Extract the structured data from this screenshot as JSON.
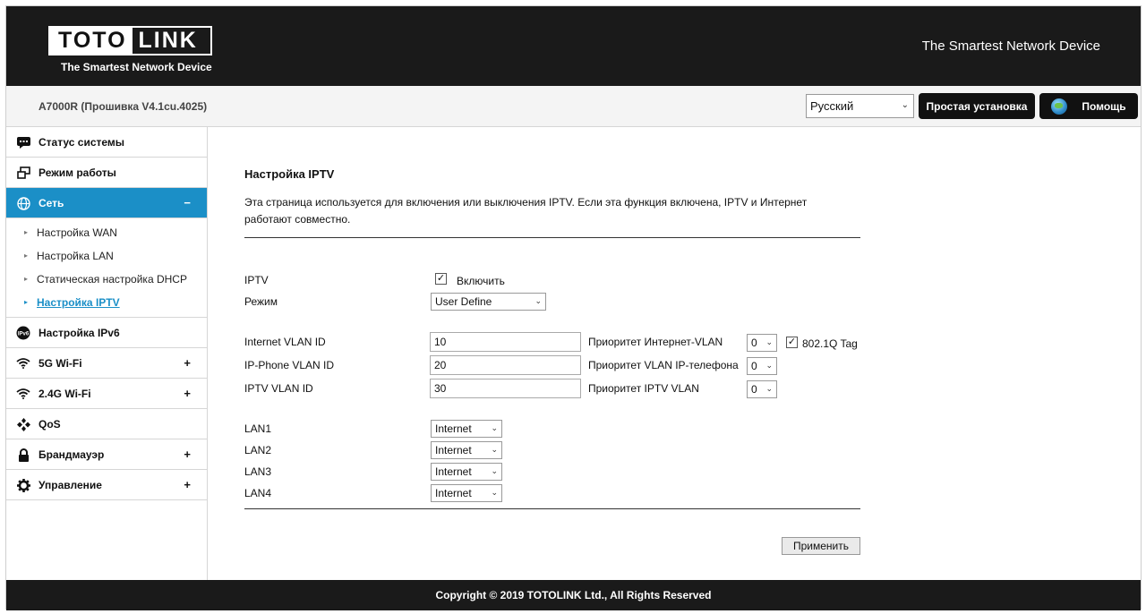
{
  "header": {
    "logo_left": "TOTO",
    "logo_right": "LINK",
    "logo_tagline": "The Smartest Network Device",
    "slogan": "The Smartest Network Device"
  },
  "subbar": {
    "model": "A7000R (Прошивка V4.1cu.4025)",
    "language": "Русский",
    "quick_setup": "Простая установка",
    "help": "Помощь"
  },
  "sidebar": {
    "items": [
      {
        "label": "Статус системы",
        "icon": "status-icon",
        "sign": ""
      },
      {
        "label": "Режим работы",
        "icon": "mode-icon",
        "sign": ""
      },
      {
        "label": "Сеть",
        "icon": "globe-icon",
        "sign": "−"
      },
      {
        "label": "Настройка IPv6",
        "icon": "ipv6-icon",
        "sign": ""
      },
      {
        "label": "5G Wi-Fi",
        "icon": "wifi-icon",
        "sign": "+"
      },
      {
        "label": "2.4G Wi-Fi",
        "icon": "wifi-icon",
        "sign": "+"
      },
      {
        "label": "QoS",
        "icon": "qos-icon",
        "sign": ""
      },
      {
        "label": "Брандмауэр",
        "icon": "lock-icon",
        "sign": "+"
      },
      {
        "label": "Управление",
        "icon": "gear-icon",
        "sign": "+"
      }
    ],
    "network_sub": [
      {
        "label": "Настройка WAN"
      },
      {
        "label": "Настройка LAN"
      },
      {
        "label": "Статическая настройка DHCP"
      },
      {
        "label": "Настройка IPTV"
      }
    ]
  },
  "main": {
    "title": "Настройка IPTV",
    "description": "Эта страница используется для включения или выключения IPTV. Если эта функция включена, IPTV и Интернет работают совместно.",
    "iptv_label": "IPTV",
    "enable_label": "Включить",
    "mode_label": "Режим",
    "mode_value": "User Define",
    "vlan_rows": [
      {
        "label": "Internet VLAN ID",
        "value": "10",
        "priority_label": "Приоритет Интернет-VLAN",
        "priority": "0"
      },
      {
        "label": "IP-Phone VLAN ID",
        "value": "20",
        "priority_label": "Приоритет VLAN IP-телефона",
        "priority": "0"
      },
      {
        "label": "IPTV VLAN ID",
        "value": "30",
        "priority_label": "Приоритет IPTV VLAN",
        "priority": "0"
      }
    ],
    "tag_label": "802.1Q Tag",
    "lans": [
      {
        "label": "LAN1",
        "value": "Internet"
      },
      {
        "label": "LAN2",
        "value": "Internet"
      },
      {
        "label": "LAN3",
        "value": "Internet"
      },
      {
        "label": "LAN4",
        "value": "Internet"
      }
    ],
    "apply_label": "Применить"
  },
  "footer": {
    "copyright": "Copyright © 2019 TOTOLINK Ltd., All Rights Reserved"
  },
  "colors": {
    "accent": "#1b8fc7",
    "header_bg": "#1a1a1a"
  }
}
